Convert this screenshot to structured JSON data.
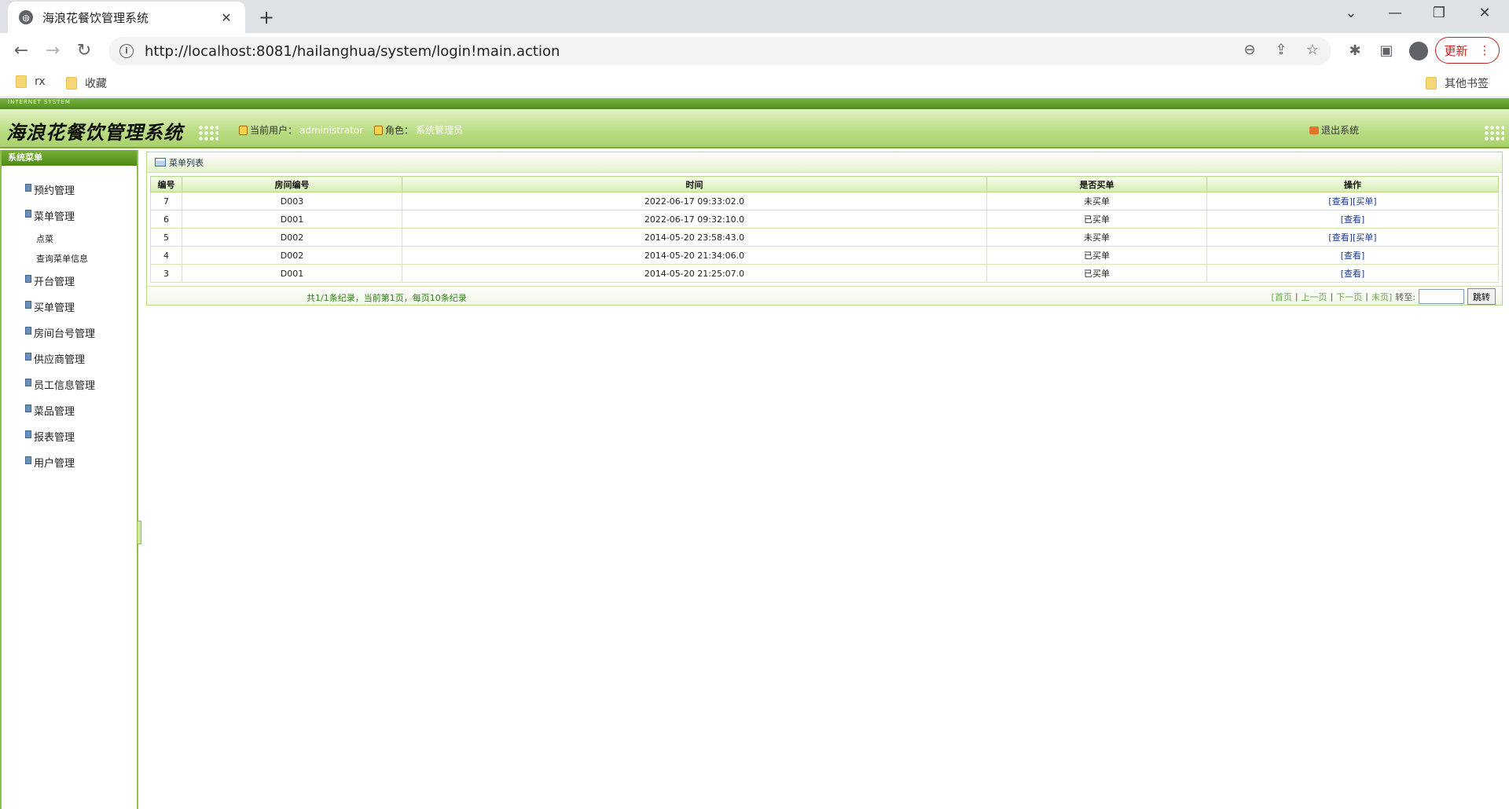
{
  "browser": {
    "tab_title": "海浪花餐饮管理系统",
    "tab_close": "✕",
    "new_tab": "+",
    "url": "http://localhost:8081/hailanghua/system/login!main.action",
    "update_label": "更新",
    "bookmarks": [
      {
        "label": "rx"
      },
      {
        "label": "收藏"
      }
    ],
    "other_bookmarks": "其他书签"
  },
  "header": {
    "strip_text": "INTERNET SYSTEM",
    "logo": "海浪花餐饮管理系统",
    "current_user_label": "当前用户：",
    "current_user": "administrator",
    "role_label": "角色：",
    "role": "系统管理员",
    "logout": "退出系统"
  },
  "sidebar": {
    "title": "系统菜单",
    "items": [
      {
        "label": "预约管理"
      },
      {
        "label": "菜单管理"
      },
      {
        "label": "点菜"
      },
      {
        "label": "查询菜单信息"
      },
      {
        "label": "开台管理"
      },
      {
        "label": "买单管理"
      },
      {
        "label": "房间台号管理"
      },
      {
        "label": "供应商管理"
      },
      {
        "label": "员工信息管理"
      },
      {
        "label": "菜品管理"
      },
      {
        "label": "报表管理"
      },
      {
        "label": "用户管理"
      }
    ]
  },
  "main": {
    "panel_title": "菜单列表",
    "columns": [
      "编号",
      "房间编号",
      "时间",
      "是否买单",
      "操作"
    ],
    "rows": [
      {
        "id": "7",
        "room": "D003",
        "time": "2022-06-17 09:33:02.0",
        "paid": "未买单",
        "ops": "[查看][买单]"
      },
      {
        "id": "6",
        "room": "D001",
        "time": "2022-06-17 09:32:10.0",
        "paid": "已买单",
        "ops": "[查看]"
      },
      {
        "id": "5",
        "room": "D002",
        "time": "2014-05-20 23:58:43.0",
        "paid": "未买单",
        "ops": "[查看][买单]"
      },
      {
        "id": "4",
        "room": "D002",
        "time": "2014-05-20 21:34:06.0",
        "paid": "已买单",
        "ops": "[查看]"
      },
      {
        "id": "3",
        "room": "D001",
        "time": "2014-05-20 21:25:07.0",
        "paid": "已买单",
        "ops": "[查看]"
      }
    ],
    "pager": {
      "summary": "共1/1条纪录，当前第1页，每页10条纪录",
      "first": "[首页",
      "sep": "|",
      "prev": "上一页",
      "next": "下一页",
      "last": "末页]",
      "goto_label": "转至:",
      "goto_button": "跳转",
      "goto_value": ""
    }
  }
}
